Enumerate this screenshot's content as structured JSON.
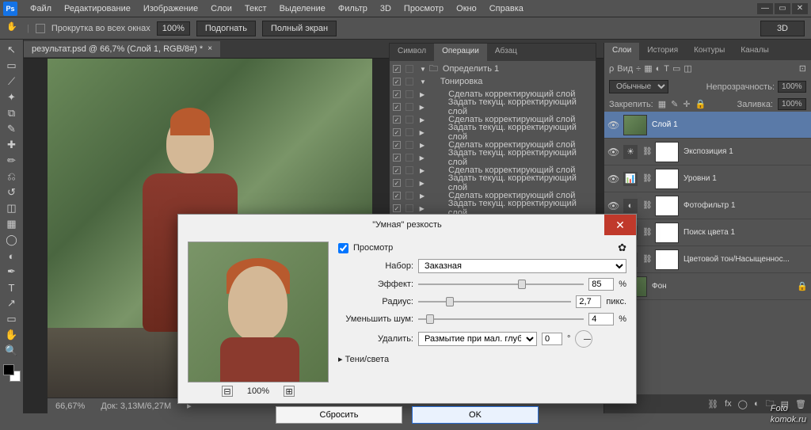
{
  "menu": {
    "items": [
      "Файл",
      "Редактирование",
      "Изображение",
      "Слои",
      "Текст",
      "Выделение",
      "Фильтр",
      "3D",
      "Просмотр",
      "Окно",
      "Справка"
    ]
  },
  "optbar": {
    "scroll_all": "Прокрутка во всех окнах",
    "zoom": "100%",
    "fit": "Подогнать",
    "fullscreen": "Полный экран",
    "workspace": "3D"
  },
  "doc_tab": "результат.psd @ 66,7% (Слой 1, RGB/8#) *",
  "status": {
    "zoom": "66,67%",
    "doc": "Док: 3,13M/6,27M"
  },
  "actions": {
    "tabs": [
      "Символ",
      "Операции",
      "Абзац"
    ],
    "set": "Определить 1",
    "action": "Тонировка",
    "steps": [
      "Сделать корректирующий слой",
      "Задать текущ. корректирующий слой",
      "Сделать корректирующий слой",
      "Задать текущ. корректирующий слой",
      "Сделать корректирующий слой",
      "Задать текущ. корректирующий слой",
      "Сделать корректирующий слой",
      "Задать текущ. корректирующий слой",
      "Сделать корректирующий слой",
      "Задать текущ. корректирующий слой"
    ]
  },
  "layers": {
    "tabs": [
      "Слои",
      "История",
      "Контуры",
      "Каналы"
    ],
    "kind": "Вид",
    "blend": "Обычные",
    "opacity_label": "Непрозрачность:",
    "opacity": "100%",
    "lock_label": "Закрепить:",
    "fill_label": "Заливка:",
    "fill": "100%",
    "items": [
      {
        "name": "Слой 1",
        "type": "image",
        "sel": true
      },
      {
        "name": "Экспозиция 1",
        "type": "adj",
        "icon": "☀"
      },
      {
        "name": "Уровни 1",
        "type": "adj",
        "icon": "📊"
      },
      {
        "name": "Фотофильтр 1",
        "type": "adj",
        "icon": "◐"
      },
      {
        "name": "Поиск цвета 1",
        "type": "adj",
        "icon": "⊞"
      },
      {
        "name": "Цветовой тон/Насыщеннос...",
        "type": "adj",
        "icon": "◧"
      },
      {
        "name": "Фон",
        "type": "bg"
      }
    ]
  },
  "dialog": {
    "title": "\"Умная\" резкость",
    "preview": "Просмотр",
    "preset_label": "Набор:",
    "preset": "Заказная",
    "amount_label": "Эффект:",
    "amount": "85",
    "amount_unit": "%",
    "radius_label": "Радиус:",
    "radius": "2,7",
    "radius_unit": "пикс.",
    "noise_label": "Уменьшить шум:",
    "noise": "4",
    "noise_unit": "%",
    "remove_label": "Удалить:",
    "remove": "Размытие при мал. глубине",
    "remove_angle": "0",
    "shadows": "Тени/света",
    "reset": "Сбросить",
    "ok": "OK",
    "zoom": "100%"
  },
  "watermark": {
    "main": "Foto",
    "sub": "komok.ru"
  }
}
